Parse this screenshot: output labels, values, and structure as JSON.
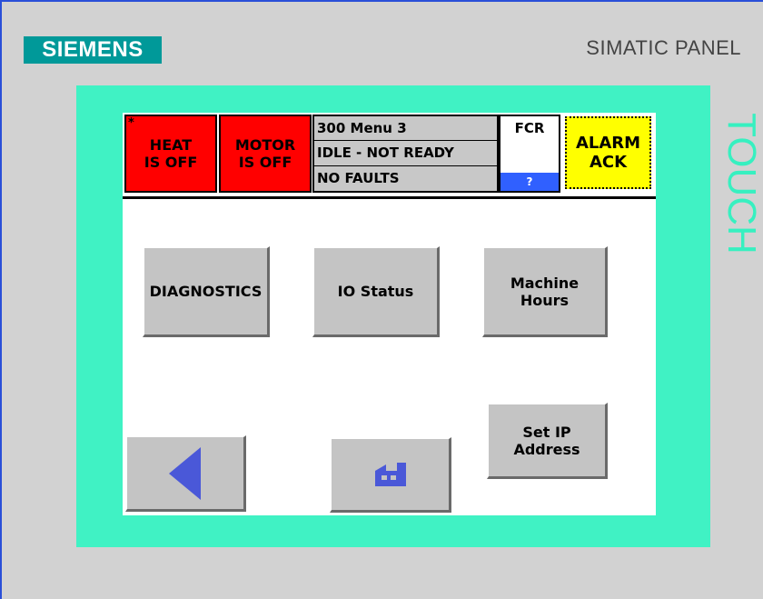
{
  "panel": {
    "brand": "SIEMENS",
    "model": "SIMATIC PANEL",
    "touch_label": "TOUCH"
  },
  "header": {
    "heat_status": "HEAT\nIS OFF",
    "heat_marker": "*",
    "motor_status": "MOTOR\nIS OFF",
    "menu_name": "300 Menu 3",
    "machine_state": "IDLE - NOT READY",
    "fault_status": "NO FAULTS",
    "fcr_label": "FCR",
    "fcr_help": "?",
    "alarm_ack": "ALARM\nACK"
  },
  "menu": {
    "diagnostics": "DIAGNOSTICS",
    "io_status": "IO Status",
    "machine_hours": "Machine\nHours",
    "set_ip": "Set IP\nAddress"
  },
  "icons": {
    "back": "left-triangle",
    "home": "factory"
  },
  "colors": {
    "brand": "#009999",
    "bezel": "#40f2c4",
    "status_off": "#ff0000",
    "alarm": "#ffff00",
    "fcr_button": "#3060ff",
    "nav_icon": "#4a58d8"
  }
}
